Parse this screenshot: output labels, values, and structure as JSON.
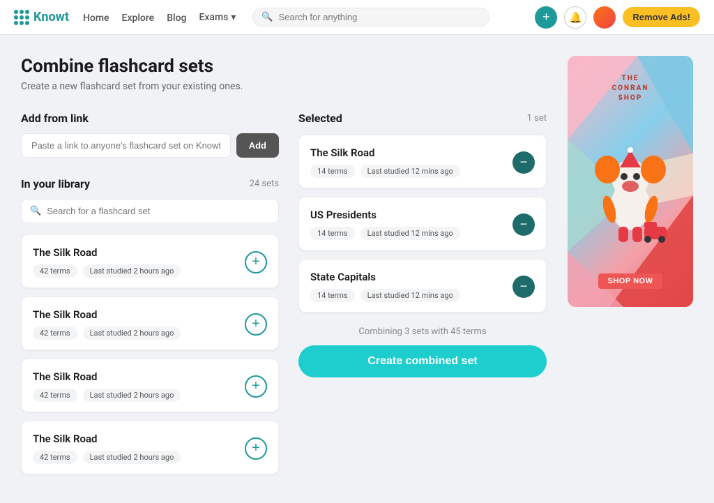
{
  "nav": {
    "logo_text": "Knowt",
    "links": [
      "Home",
      "Explore",
      "Blog"
    ],
    "exams_label": "Exams",
    "search_placeholder": "Search for anything",
    "remove_ads_label": "Remove Ads!"
  },
  "page": {
    "title": "Combine flashcard sets",
    "subtitle": "Create a new flashcard set from your existing ones."
  },
  "add_from_link": {
    "section_title": "Add from link",
    "input_placeholder": "Paste a link to anyone's flashcard set on Knowt",
    "add_button_label": "Add"
  },
  "library": {
    "section_title": "In your library",
    "count_label": "24 sets",
    "search_placeholder": "Search for a flashcard set",
    "items": [
      {
        "title": "The Silk Road",
        "terms": "42 terms",
        "last_studied": "Last studied 2 hours ago"
      },
      {
        "title": "The Silk Road",
        "terms": "42 terms",
        "last_studied": "Last studied 2 hours ago"
      },
      {
        "title": "The Silk Road",
        "terms": "42 terms",
        "last_studied": "Last studied 2 hours ago"
      },
      {
        "title": "The Silk Road",
        "terms": "42 terms",
        "last_studied": "Last studied 2 hours ago"
      }
    ]
  },
  "selected": {
    "section_title": "Selected",
    "count_label": "1 set",
    "items": [
      {
        "title": "The Silk Road",
        "terms": "14 terms",
        "last_studied": "Last studied 12 mins ago"
      },
      {
        "title": "US Presidents",
        "terms": "14 terms",
        "last_studied": "Last studied 12 mins ago"
      },
      {
        "title": "State Capitals",
        "terms": "14 terms",
        "last_studied": "Last studied 12 mins ago"
      }
    ],
    "combining_text": "Combining 3 sets with 45 terms",
    "create_button_label": "Create combined set"
  },
  "ad": {
    "title_line1": "THE",
    "title_line2": "CONRAN",
    "title_line3": "SHOP",
    "shop_now_label": "shop now"
  }
}
